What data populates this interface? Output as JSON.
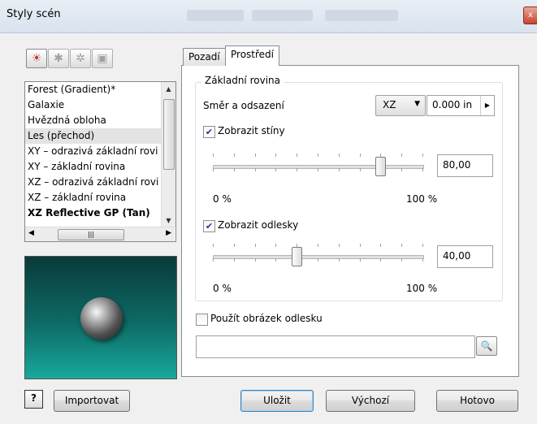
{
  "window": {
    "title": "Styly scén",
    "close_label": "x"
  },
  "toolbar": {
    "icons": [
      "scene-style-icon",
      "light-icon",
      "light-style-icon",
      "settings-icon"
    ]
  },
  "scene_list": {
    "items": [
      "Forest (Gradient)*",
      "Galaxie",
      "Hvězdná obloha",
      "Les (přechod)",
      "XY – odrazivá základní rovi",
      "XY – základní rovina",
      "XZ – odrazivá základní rovi",
      "XZ – základní rovina",
      "XZ Reflective GP (Tan)"
    ],
    "selected_index": 3,
    "bold_index": 8
  },
  "tabs": [
    "Pozadí",
    "Prostředí"
  ],
  "active_tab": 1,
  "ground_plane": {
    "group_label": "Základní rovina",
    "direction_label": "Směr a odsazení",
    "direction_value": "XZ",
    "offset_value": "0.000 in",
    "shadows": {
      "label": "Zobrazit stíny",
      "checked": true,
      "value": "80,00",
      "level": 0.8,
      "min_label": "0 %",
      "max_label": "100 %"
    },
    "reflections": {
      "label": "Zobrazit odlesky",
      "checked": true,
      "value": "40,00",
      "level": 0.4,
      "min_label": "0 %",
      "max_label": "100 %"
    }
  },
  "reflection_image": {
    "label": "Použít obrázek odlesku",
    "checked": false,
    "path": ""
  },
  "buttons": {
    "help": "?",
    "import": "Importovat",
    "save": "Uložit",
    "default": "Výchozí",
    "done": "Hotovo"
  }
}
